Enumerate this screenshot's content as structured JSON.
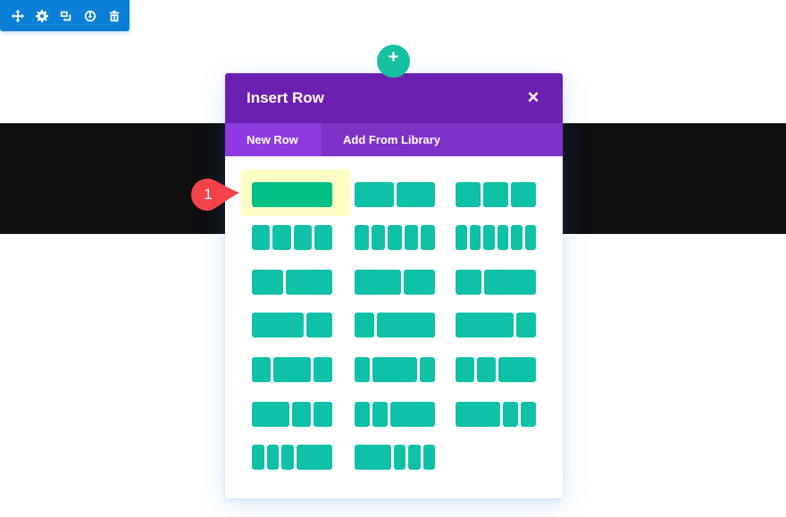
{
  "toolbar": {
    "buttons": [
      {
        "name": "move",
        "icon": "move-icon"
      },
      {
        "name": "settings",
        "icon": "gear-icon"
      },
      {
        "name": "duplicate",
        "icon": "duplicate-icon"
      },
      {
        "name": "save",
        "icon": "save-icon"
      },
      {
        "name": "delete",
        "icon": "trash-icon"
      }
    ],
    "color": "#0c80d6"
  },
  "add_button": {
    "label": "+",
    "icon": "plus-icon",
    "color": "#18c0a3"
  },
  "modal": {
    "title": "Insert Row",
    "close_label": "×",
    "tabs": [
      {
        "label": "New Row",
        "active": true
      },
      {
        "label": "Add From Library",
        "active": false
      }
    ],
    "header_color": "#6b1fb0",
    "tab_bar_color": "#7e32c8",
    "active_tab_color": "#8e3ae0"
  },
  "layouts": [
    {
      "name": "1",
      "cols": [
        1
      ],
      "selected": true
    },
    {
      "name": "1/2,1/2",
      "cols": [
        1,
        1
      ]
    },
    {
      "name": "1/3,1/3,1/3",
      "cols": [
        1,
        1,
        1
      ]
    },
    {
      "name": "1/4 x4",
      "cols": [
        1,
        1,
        1,
        1
      ]
    },
    {
      "name": "1/5 x5",
      "cols": [
        1,
        1,
        1,
        1,
        1
      ]
    },
    {
      "name": "1/6 x6",
      "cols": [
        1,
        1,
        1,
        1,
        1,
        1
      ]
    },
    {
      "name": "2/5,3/5",
      "cols": [
        2,
        3
      ]
    },
    {
      "name": "3/5,2/5",
      "cols": [
        3,
        2
      ]
    },
    {
      "name": "1/3,2/3",
      "cols": [
        1,
        2
      ]
    },
    {
      "name": "2/3,1/3",
      "cols": [
        2,
        1
      ]
    },
    {
      "name": "1/4,3/4",
      "cols": [
        1,
        3
      ]
    },
    {
      "name": "3/4,1/4",
      "cols": [
        3,
        1
      ]
    },
    {
      "name": "1/4,1/2,1/4",
      "cols": [
        1,
        2,
        1
      ]
    },
    {
      "name": "1/5,3/5,1/5",
      "cols": [
        1,
        3,
        1
      ]
    },
    {
      "name": "1/4,1/4,1/2",
      "cols": [
        1,
        1,
        2
      ]
    },
    {
      "name": "1/2,1/4,1/4",
      "cols": [
        2,
        1,
        1
      ]
    },
    {
      "name": "1/5,1/5,3/5",
      "cols": [
        1,
        1,
        3
      ]
    },
    {
      "name": "3/5,1/5,1/5",
      "cols": [
        3,
        1,
        1
      ]
    },
    {
      "name": "1/6,1/6,1/6,1/2",
      "cols": [
        1,
        1,
        1,
        3
      ]
    },
    {
      "name": "1/2,1/6,1/6,1/6",
      "cols": [
        3,
        1,
        1,
        1
      ]
    }
  ],
  "layout_color": "#0fc1a7",
  "selected_color": "#04c085",
  "highlight_color": "#fefdc6",
  "marker": {
    "label": "1",
    "color": "#f2434a"
  }
}
